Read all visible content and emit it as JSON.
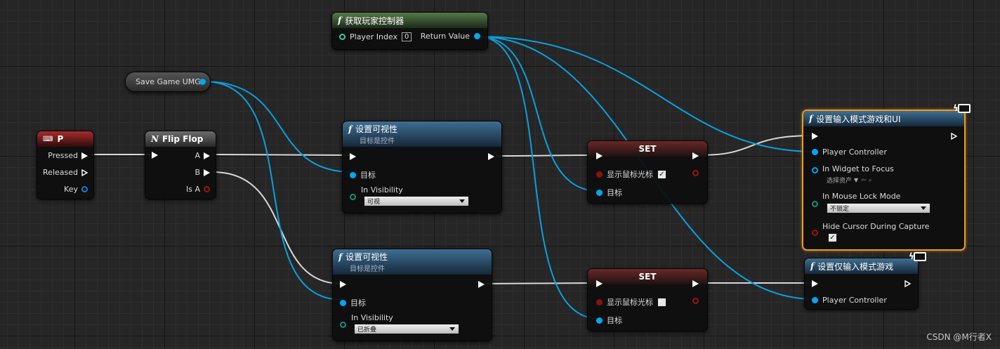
{
  "nodes": {
    "get_controller": {
      "title": "获取玩家控制器",
      "player_index_label": "Player Index",
      "player_index_value": "0",
      "return_label": "Return Value"
    },
    "save_game": {
      "label": "Save Game UMG"
    },
    "p_key": {
      "title": "P",
      "pressed": "Pressed",
      "released": "Released",
      "key": "Key"
    },
    "flip_flop": {
      "title": "Flip Flop",
      "a": "A",
      "b": "B",
      "is_a": "Is A"
    },
    "set_vis_1": {
      "title": "设置可视性",
      "subtitle": "目标是控件",
      "target": "目标",
      "vis_label": "In Visibility",
      "vis_value": "可视"
    },
    "set_vis_2": {
      "title": "设置可视性",
      "subtitle": "目标是控件",
      "target": "目标",
      "vis_label": "In Visibility",
      "vis_value": "已折叠"
    },
    "set_1": {
      "title": "SET",
      "show_cursor": "显示鼠标光标",
      "checked": true,
      "target": "目标"
    },
    "set_2": {
      "title": "SET",
      "show_cursor": "显示鼠标光标",
      "checked": false,
      "target": "目标"
    },
    "input_game_ui": {
      "title": "设置输入模式游戏和UI",
      "player_controller": "Player Controller",
      "widget_focus": "In Widget to Focus",
      "select_asset": "选择资产",
      "mouse_lock": "In Mouse Lock Mode",
      "mouse_lock_value": "不锁定",
      "hide_cursor": "Hide Cursor During Capture",
      "hide_checked": true
    },
    "input_game_only": {
      "title": "设置仅输入模式游戏",
      "player_controller": "Player Controller"
    }
  },
  "watermark": "CSDN @M行者X",
  "colors": {
    "exec": "#ffffff",
    "object_pin": "#00a8f0",
    "bool_pin": "#a01010",
    "selection": "#f09a1c"
  }
}
